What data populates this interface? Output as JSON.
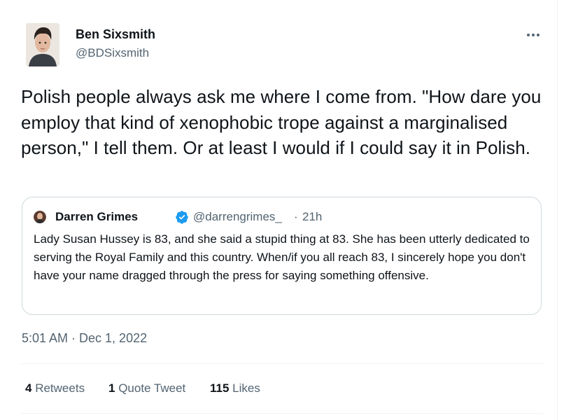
{
  "author": {
    "name": "Ben Sixsmith",
    "handle": "@BDSixsmith",
    "avatar_icon": "user-photo-avatar"
  },
  "tweet": {
    "text": "Polish people always ask me where I come from. \"How dare you employ that kind of xenophobic trope against a marginalised person,\" I tell them. Or at least I would if I could say it in Polish."
  },
  "quoted": {
    "name": "Darren Grimes",
    "handle": "@darrengrimes_",
    "separator": "·",
    "time": "21h",
    "verified": true,
    "verified_icon": "verified-badge-icon",
    "text": "Lady Susan Hussey is 83, and she said a stupid thing at 83. She has been utterly dedicated to serving the Royal Family and this country. When/if you all reach 83, I sincerely hope you don't have your name dragged through the press for saying something offensive."
  },
  "meta": {
    "timestamp": "5:01 AM · Dec 1, 2022"
  },
  "stats": {
    "retweets_count": "4",
    "retweets_label": "Retweets",
    "quotes_count": "1",
    "quotes_label": "Quote Tweet",
    "likes_count": "115",
    "likes_label": "Likes"
  },
  "colors": {
    "text": "#0f1419",
    "secondary": "#536471",
    "verified": "#1d9bf0",
    "border": "#cfd9de"
  }
}
